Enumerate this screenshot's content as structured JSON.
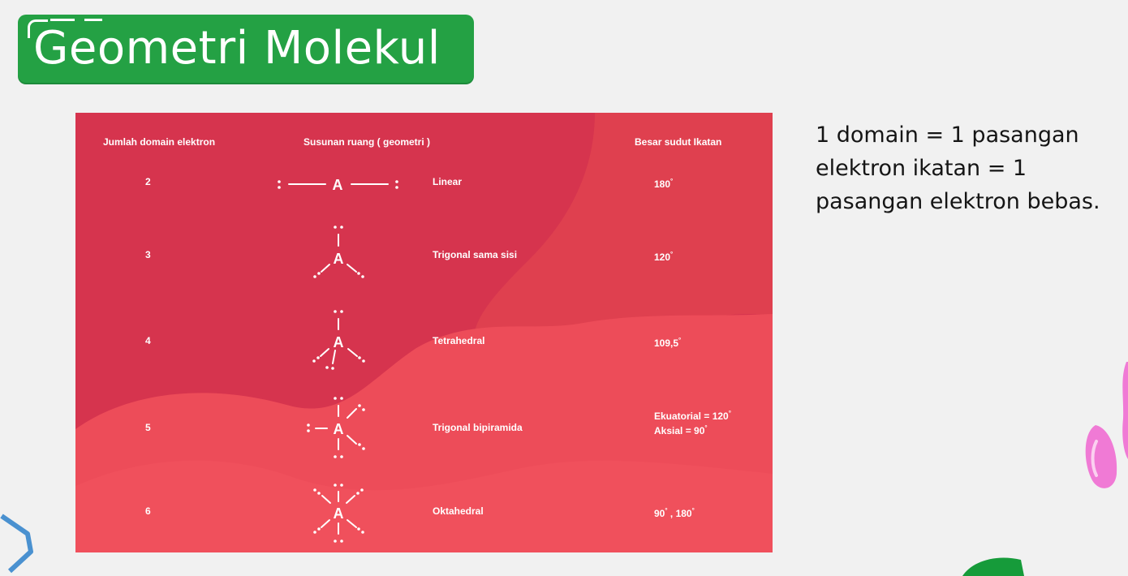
{
  "title": "Geometri Molekul",
  "table": {
    "headers": {
      "domain": "Jumlah domain elektron",
      "geometry": "Susunan ruang ( geometri )",
      "angle": "Besar sudut Ikatan"
    },
    "rows": [
      {
        "domain": "2",
        "geometry": "Linear",
        "angle": "180",
        "angle_sup": "°"
      },
      {
        "domain": "3",
        "geometry": "Trigonal sama sisi",
        "angle": "120",
        "angle_sup": "°"
      },
      {
        "domain": "4",
        "geometry": "Tetrahedral",
        "angle": "109,5",
        "angle_sup": "°"
      },
      {
        "domain": "5",
        "geometry": "Trigonal bipiramida",
        "angle_line1": "Ekuatorial = 120",
        "angle_line1_sup": "°",
        "angle_line2": "Aksial = 90",
        "angle_line2_sup": "°"
      },
      {
        "domain": "6",
        "geometry": "Oktahedral",
        "angle": "90",
        "angle_sup": "°",
        "angle_sep": " , ",
        "angle_b": "180",
        "angle_b_sup": "°"
      }
    ],
    "central_atom": "A"
  },
  "note": "1 domain = 1 pasangan elektron ikatan = 1 pasangan elektron bebas.",
  "colors": {
    "title_bg": "#24a144",
    "panel_dark": "#d6344e",
    "panel_light": "#f04f5b",
    "page_bg": "#f1f1f1",
    "decor_blue": "#4a91d0",
    "decor_pink": "#f07ad5",
    "decor_green": "#169b3a"
  }
}
